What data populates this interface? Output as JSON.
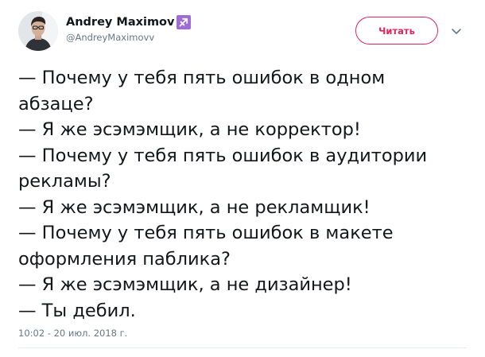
{
  "tweet": {
    "author": {
      "display_name": "Andrey Maximov",
      "handle": "@AndreyMaximovv",
      "badge_icon": "sagittarius-icon"
    },
    "follow_button_label": "Читать",
    "text_lines": [
      "— Почему у тебя пять ошибок в одном",
      "абзаце?",
      "— Я же эсэмэмщик, а не корректор!",
      "— Почему у тебя пять ошибок в аудитории",
      "рекламы?",
      "— Я же эсэмэмщик, а не рекламщик!",
      "— Почему у тебя пять ошибок в макете",
      "оформления паблика?",
      "— Я же эсэмэмщик, а не дизайнер!",
      "— Ты дебил."
    ],
    "timestamp": "10:02 - 20 июл. 2018 г."
  },
  "colors": {
    "accent": "#e0245e",
    "badge": "#9f6bd6",
    "secondary_text": "#657786",
    "primary_text": "#14171a"
  }
}
